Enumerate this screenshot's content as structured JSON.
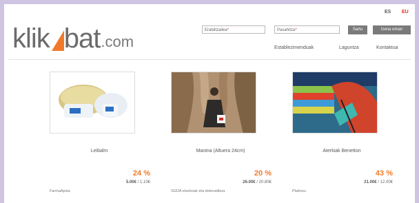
{
  "header": {
    "logo": {
      "part1": "klik",
      "part2": "bat",
      "suffix": ".com",
      "accent_color": "#f07a2a"
    },
    "languages": [
      {
        "label": "ES"
      },
      {
        "label": "EU"
      }
    ],
    "login": {
      "username_placeholder": "Erabiltzailea",
      "password_placeholder": "Pasahitza",
      "required_marker": "*",
      "submit_label": "Sartu",
      "register_label": "Izena eman"
    },
    "nav": [
      {
        "label": "Establezimenduak"
      },
      {
        "label": "Laguntza"
      },
      {
        "label": "Kontaktua"
      }
    ]
  },
  "products": [
    {
      "name": "Leibalm",
      "discount": "24 %",
      "old_price": "5.00€",
      "new_price": "1.10€",
      "store": "FarmaApsia",
      "image": "cream-jar-photo"
    },
    {
      "name": "Manina (Altuera 24cm)",
      "discount": "20 %",
      "old_price": "26.00€",
      "new_price": "20.80€",
      "store": "SGDA etxekoak eta dekoratiboa",
      "image": "doll-figure-photo"
    },
    {
      "name": "Aterkiak Benetton",
      "discount": "43 %",
      "old_price": "21.00€",
      "new_price": "12.00€",
      "store": "Platinou",
      "image": "umbrella-photo"
    }
  ]
}
